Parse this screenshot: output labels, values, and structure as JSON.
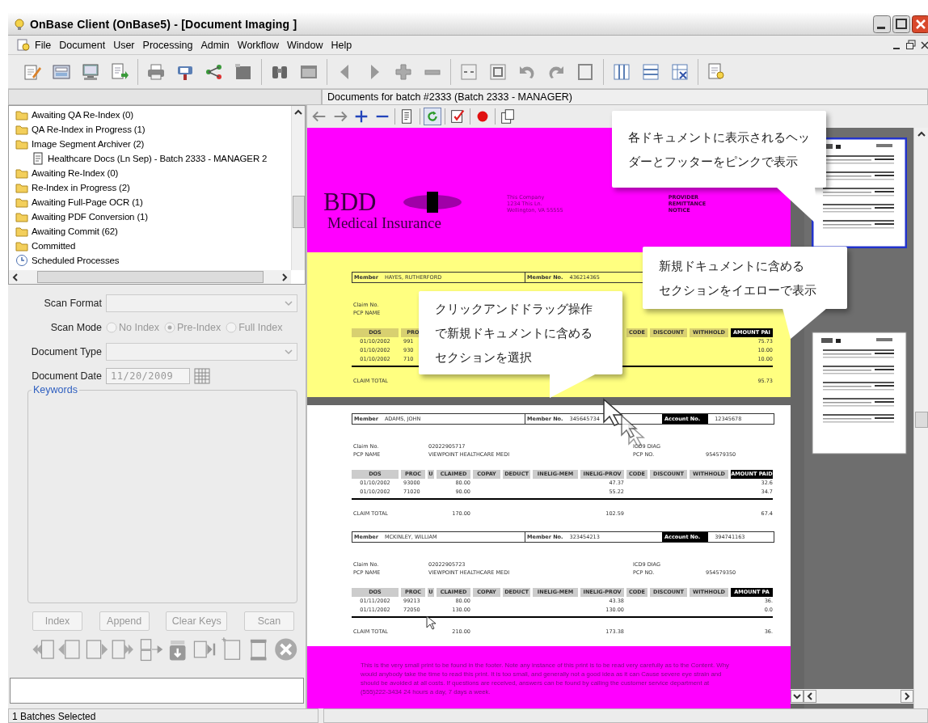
{
  "window": {
    "title": "OnBase Client (OnBase5) - [Document Imaging ]"
  },
  "menu": [
    "File",
    "Document",
    "User",
    "Processing",
    "Admin",
    "Workflow",
    "Window",
    "Help"
  ],
  "batch_label": "Documents for batch #2333 (Batch 2333 - MANAGER)",
  "tree": [
    {
      "label": "Awaiting QA Re-Index (0)",
      "kind": "folder"
    },
    {
      "label": "QA Re-Index in Progress (1)",
      "kind": "folder"
    },
    {
      "label": "Image Segment Archiver (2)",
      "kind": "folder",
      "children": [
        {
          "label": "Healthcare Docs (Ln Sep) - Batch 2333 - MANAGER 2",
          "kind": "document"
        }
      ]
    },
    {
      "label": "Awaiting Re-Index (0)",
      "kind": "folder"
    },
    {
      "label": "Re-Index in Progress (2)",
      "kind": "folder"
    },
    {
      "label": "Awaiting Full-Page OCR (1)",
      "kind": "folder"
    },
    {
      "label": "Awaiting PDF Conversion (1)",
      "kind": "folder"
    },
    {
      "label": "Awaiting Commit (62)",
      "kind": "folder"
    },
    {
      "label": "Committed",
      "kind": "folder"
    },
    {
      "label": "Scheduled Processes",
      "kind": "schedule"
    }
  ],
  "scan_form": {
    "fields": [
      {
        "kind": "select",
        "label": "Scan Format",
        "disabled": true
      },
      {
        "kind": "radio",
        "label": "Scan Mode",
        "disabled": true,
        "options": [
          {
            "label": "No Index",
            "selected": false
          },
          {
            "label": "Pre-Index",
            "selected": true
          },
          {
            "label": "Full Index",
            "selected": false
          }
        ]
      },
      {
        "kind": "select",
        "label": "Document Type",
        "disabled": true
      },
      {
        "kind": "date",
        "label": "Document Date",
        "value": "11/20/2009",
        "disabled": true
      }
    ],
    "keywords_label": "Keywords",
    "buttons": [
      {
        "label": "Index",
        "disabled": true
      },
      {
        "label": "Append",
        "disabled": true
      },
      {
        "label": "Clear Keys",
        "disabled": true
      },
      {
        "label": "Scan",
        "disabled": true
      }
    ]
  },
  "document": {
    "logo": {
      "name": "BDD",
      "subtitle": "Medical Insurance"
    },
    "company": [
      "This Company",
      "1234 This Ln.",
      "Wellington, VA 55555"
    ],
    "notice": [
      "PROVIDER",
      "REMITTANCE",
      "NOTICE"
    ],
    "claims": [
      {
        "selected": true,
        "member_label": "Member",
        "member": "HAYES, RUTHERFORD",
        "member_no_label": "Member No.",
        "member_no": "436214365",
        "claim_no_label": "Claim No.",
        "pcp_name_label": "PCP NAME",
        "columns": {
          "dos": "DOS",
          "proc": "PRO",
          "code": "CODE",
          "discount": "DISCOUNT",
          "withhold": "WITHHOLD",
          "amount_paid": "AMOUNT PAI"
        },
        "rows": [
          {
            "dos": "01/10/2002",
            "proc": "991",
            "amount_paid": "75.73"
          },
          {
            "dos": "01/10/2002",
            "proc": "930",
            "amount_paid": "10.00"
          },
          {
            "dos": "01/10/2002",
            "proc": "710",
            "amount_paid": "10.00"
          }
        ],
        "total_label": "CLAIM TOTAL",
        "totals": {
          "amount_paid": "95.73"
        }
      },
      {
        "selected": false,
        "member_label": "Member",
        "member": "ADAMS, JOHN",
        "member_no_label": "Member No.",
        "member_no": "345645734",
        "account_label": "Account No.",
        "account_no": "12345678",
        "claim_no_label": "Claim No.",
        "claim_no": "02022905717",
        "pcp_name_label": "PCP NAME",
        "pcp_name": "VIEWPOINT HEALTHCARE MEDI",
        "icd_label": "ICD9 DIAG",
        "pcp_no_label": "PCP NO.",
        "pcp_no": "954579350",
        "columns": {
          "dos": "DOS",
          "proc": "PROC",
          "u": "U",
          "claimed": "CLAIMED",
          "copay": "COPAY",
          "deduct": "DEDUCT",
          "inelig_mem": "INELIG-MEM",
          "inelig_prov": "INELIG-PROV",
          "code": "CODE",
          "discount": "DISCOUNT",
          "withhold": "WITHHOLD",
          "amount_paid": "AMOUNT PAID"
        },
        "rows": [
          {
            "dos": "01/10/2002",
            "proc": "93000",
            "claimed": "80.00",
            "inelig_prov": "47.37",
            "amount_paid": "32.6"
          },
          {
            "dos": "01/10/2002",
            "proc": "71020",
            "claimed": "90.00",
            "inelig_prov": "55.22",
            "amount_paid": "34.7"
          }
        ],
        "total_label": "CLAIM TOTAL",
        "totals": {
          "claimed": "170.00",
          "inelig_prov": "102.59",
          "amount_paid": "67.4"
        }
      },
      {
        "selected": false,
        "member_label": "Member",
        "member": "MCKINLEY, WILLIAM",
        "member_no_label": "Member No.",
        "member_no": "323454213",
        "account_label": "Account No.",
        "account_no": "394741163",
        "claim_no_label": "Claim No.",
        "claim_no": "02022905723",
        "pcp_name_label": "PCP NAME",
        "pcp_name": "VIEWPOINT HEALTHCARE MEDI",
        "icd_label": "ICD9 DIAG",
        "pcp_no_label": "PCP NO.",
        "pcp_no": "954579350",
        "columns": {
          "dos": "DOS",
          "proc": "PROC",
          "u": "U",
          "claimed": "CLAIMED",
          "copay": "COPAY",
          "deduct": "DEDUCT",
          "inelig_mem": "INELIG-MEM",
          "inelig_prov": "INELIG-PROV",
          "code": "CODE",
          "discount": "DISCOUNT",
          "withhold": "WITHHOLD",
          "amount_paid": "AMOUNT PA"
        },
        "rows": [
          {
            "dos": "01/11/2002",
            "proc": "99213",
            "claimed": "80.00",
            "inelig_prov": "43.38",
            "amount_paid": "36."
          },
          {
            "dos": "01/11/2002",
            "proc": "72050",
            "claimed": "130.00",
            "inelig_prov": "130.00",
            "amount_paid": "0.0"
          }
        ],
        "total_label": "CLAIM TOTAL",
        "totals": {
          "claimed": "210.00",
          "inelig_prov": "173.38",
          "amount_paid": "36."
        }
      }
    ],
    "footer": "This is the very small print to be found in the footer.  Note any instance of this print is to be read very carefully as to the Content.  Why would anybody take the time to read this print.  It is too small, and generally not a good idea as it can Cause severe eye strain and should be avoided at all costs.  If questions are received, answers can be found by calling the customer service department at (555)222-3434 24 hours a day, 7 days a week."
  },
  "thumbnails": [
    {
      "selected": true
    },
    {
      "selected": false
    }
  ],
  "callouts": [
    {
      "lines": [
        "各ドキュメントに表示されるヘッ",
        "ダーとフッターをピンクで表示"
      ]
    },
    {
      "lines": [
        "新規ドキュメントに含める",
        "セクションをイエローで表示"
      ]
    },
    {
      "lines": [
        "クリックアンドドラッグ操作",
        "で新規ドキュメントに含める",
        "セクションを選択"
      ]
    }
  ],
  "status_bar": "1 Batches Selected"
}
